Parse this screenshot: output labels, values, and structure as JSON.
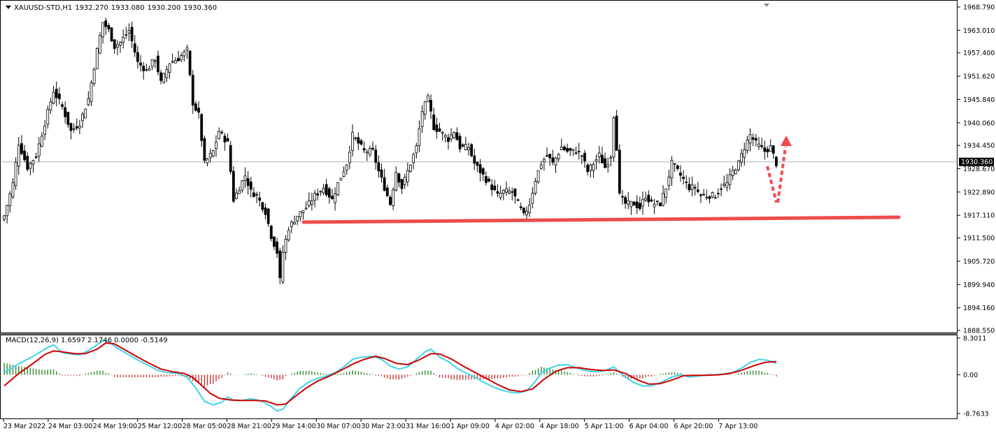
{
  "header": {
    "symbol": "XAUUSD-STD,H1",
    "open": "1932.270",
    "high": "1933.080",
    "low": "1930.200",
    "close": "1930.360"
  },
  "macd_header": {
    "label": "MACD(12,26,9)",
    "v1": "1.6597",
    "v2": "2.1746",
    "v3": "0.0000",
    "v4": "-0.5149"
  },
  "colors": {
    "bull": "#000000",
    "bear": "#000000",
    "support_line": "#ef4c4c",
    "arrow": "#ef4c4c",
    "macd_line": "#3fd4e8",
    "signal_line": "#cc0000",
    "hist_pos": "#2e8b2e",
    "hist_neg": "#cc3333",
    "price_line": "#8aa0a8"
  },
  "chart_data": [
    {
      "type": "candlestick",
      "title": "XAUUSD-STD,H1",
      "ylim": [
        1888.55,
        1968.79
      ],
      "y_ticks": [
        "1968.790",
        "1963.010",
        "1957.400",
        "1951.620",
        "1945.840",
        "1940.060",
        "1934.450",
        "1928.670",
        "1922.890",
        "1917.110",
        "1911.500",
        "1905.720",
        "1899.940",
        "1894.160",
        "1888.550"
      ],
      "x_ticks": [
        "23 Mar 2022",
        "24 Mar 03:00",
        "24 Mar 19:00",
        "25 Mar 12:00",
        "28 Mar 05:00",
        "28 Mar 21:00",
        "29 Mar 14:00",
        "30 Mar 07:00",
        "30 Mar 23:00",
        "31 Mar 16:00",
        "1 Apr 09:00",
        "4 Apr 02:00",
        "4 Apr 18:00",
        "5 Apr 11:00",
        "6 Apr 04:00",
        "6 Apr 20:00",
        "7 Apr 13:00"
      ],
      "current_price": "1930.360",
      "anchors": [
        [
          0,
          1917
        ],
        [
          3,
          1925
        ],
        [
          5,
          1935
        ],
        [
          8,
          1929
        ],
        [
          11,
          1932
        ],
        [
          14,
          1940
        ],
        [
          17,
          1948
        ],
        [
          20,
          1944
        ],
        [
          23,
          1938
        ],
        [
          26,
          1940
        ],
        [
          29,
          1946
        ],
        [
          32,
          1958
        ],
        [
          34,
          1965
        ],
        [
          36,
          1963
        ],
        [
          38,
          1959
        ],
        [
          40,
          1960
        ],
        [
          43,
          1963
        ],
        [
          46,
          1955
        ],
        [
          49,
          1953
        ],
        [
          52,
          1956
        ],
        [
          54,
          1950
        ],
        [
          57,
          1955
        ],
        [
          60,
          1956
        ],
        [
          63,
          1958
        ],
        [
          65,
          1945
        ],
        [
          67,
          1942
        ],
        [
          69,
          1930
        ],
        [
          72,
          1933
        ],
        [
          74,
          1938
        ],
        [
          77,
          1935
        ],
        [
          79,
          1921
        ],
        [
          81,
          1924
        ],
        [
          83,
          1927
        ],
        [
          85,
          1923
        ],
        [
          87,
          1922
        ],
        [
          90,
          1918
        ],
        [
          92,
          1912
        ],
        [
          94,
          1908
        ],
        [
          95,
          1901
        ],
        [
          96,
          1908
        ],
        [
          98,
          1914
        ],
        [
          101,
          1917
        ],
        [
          104,
          1919
        ],
        [
          107,
          1922
        ],
        [
          110,
          1924
        ],
        [
          113,
          1921
        ],
        [
          115,
          1925
        ],
        [
          118,
          1930
        ],
        [
          120,
          1937
        ],
        [
          122,
          1935
        ],
        [
          124,
          1933
        ],
        [
          127,
          1933
        ],
        [
          129,
          1928
        ],
        [
          131,
          1924
        ],
        [
          133,
          1920
        ],
        [
          135,
          1928
        ],
        [
          137,
          1924
        ],
        [
          139,
          1928
        ],
        [
          142,
          1934
        ],
        [
          144,
          1943
        ],
        [
          146,
          1946
        ],
        [
          148,
          1939
        ],
        [
          150,
          1938
        ],
        [
          153,
          1936
        ],
        [
          155,
          1938
        ],
        [
          157,
          1934
        ],
        [
          160,
          1934
        ],
        [
          162,
          1930
        ],
        [
          164,
          1928
        ],
        [
          167,
          1925
        ],
        [
          170,
          1922
        ],
        [
          172,
          1923
        ],
        [
          175,
          1923
        ],
        [
          177,
          1920
        ],
        [
          179,
          1917
        ],
        [
          181,
          1920
        ],
        [
          183,
          1926
        ],
        [
          185,
          1930
        ],
        [
          187,
          1932
        ],
        [
          189,
          1930
        ],
        [
          192,
          1934
        ],
        [
          194,
          1933
        ],
        [
          197,
          1933
        ],
        [
          199,
          1932
        ],
        [
          201,
          1928
        ],
        [
          203,
          1930
        ],
        [
          205,
          1932
        ],
        [
          207,
          1929
        ],
        [
          209,
          1932
        ],
        [
          210,
          1942
        ],
        [
          211,
          1934
        ],
        [
          212,
          1922
        ],
        [
          214,
          1920
        ],
        [
          217,
          1920
        ],
        [
          219,
          1919
        ],
        [
          221,
          1922
        ],
        [
          223,
          1920
        ],
        [
          226,
          1920
        ],
        [
          228,
          1924
        ],
        [
          230,
          1930
        ],
        [
          232,
          1928
        ],
        [
          234,
          1926
        ],
        [
          236,
          1924
        ],
        [
          238,
          1924
        ],
        [
          240,
          1922
        ],
        [
          243,
          1922
        ],
        [
          245,
          1922
        ],
        [
          247,
          1924
        ],
        [
          249,
          1925
        ],
        [
          251,
          1928
        ],
        [
          253,
          1930
        ],
        [
          255,
          1934
        ],
        [
          257,
          1937
        ],
        [
          259,
          1935
        ],
        [
          262,
          1933
        ],
        [
          264,
          1934
        ],
        [
          266,
          1930
        ]
      ],
      "series_name": "XAUUSD-STD,H1"
    },
    {
      "type": "macd",
      "title": "MACD(12,26,9)",
      "ylim": [
        -8.7633,
        8.3011
      ],
      "y_ticks": [
        "8.3011",
        "0.00",
        "-8.7633"
      ],
      "macd_anchors": [
        [
          0,
          0.5
        ],
        [
          5,
          2.5
        ],
        [
          10,
          4.2
        ],
        [
          14,
          5.8
        ],
        [
          17,
          6.8
        ],
        [
          20,
          5.0
        ],
        [
          23,
          4.7
        ],
        [
          26,
          4.5
        ],
        [
          29,
          5.5
        ],
        [
          32,
          6.8
        ],
        [
          34,
          7.8
        ],
        [
          36,
          7.5
        ],
        [
          39,
          6.0
        ],
        [
          43,
          4.5
        ],
        [
          47,
          3.0
        ],
        [
          50,
          2.0
        ],
        [
          53,
          1.0
        ],
        [
          56,
          0.5
        ],
        [
          60,
          0.3
        ],
        [
          63,
          -0.5
        ],
        [
          66,
          -3.0
        ],
        [
          69,
          -6.0
        ],
        [
          72,
          -6.8
        ],
        [
          75,
          -6.2
        ],
        [
          77,
          -5.0
        ],
        [
          79,
          -5.8
        ],
        [
          82,
          -5.8
        ],
        [
          85,
          -5.4
        ],
        [
          88,
          -5.8
        ],
        [
          90,
          -6.4
        ],
        [
          92,
          -7.2
        ],
        [
          94,
          -8.2
        ],
        [
          96,
          -7.8
        ],
        [
          99,
          -5.2
        ],
        [
          102,
          -3.0
        ],
        [
          105,
          -1.6
        ],
        [
          108,
          -0.8
        ],
        [
          111,
          -0.3
        ],
        [
          114,
          0.5
        ],
        [
          117,
          1.8
        ],
        [
          120,
          3.5
        ],
        [
          123,
          4.0
        ],
        [
          127,
          4.2
        ],
        [
          130,
          3.5
        ],
        [
          133,
          2.0
        ],
        [
          136,
          1.3
        ],
        [
          139,
          1.8
        ],
        [
          142,
          3.5
        ],
        [
          145,
          5.2
        ],
        [
          147,
          5.8
        ],
        [
          150,
          4.0
        ],
        [
          153,
          3.0
        ],
        [
          156,
          1.5
        ],
        [
          159,
          0.4
        ],
        [
          162,
          -0.5
        ],
        [
          165,
          -1.6
        ],
        [
          168,
          -2.6
        ],
        [
          171,
          -3.4
        ],
        [
          174,
          -3.9
        ],
        [
          177,
          -4.1
        ],
        [
          180,
          -3.6
        ],
        [
          183,
          -1.5
        ],
        [
          185,
          0.5
        ],
        [
          188,
          1.5
        ],
        [
          191,
          2.2
        ],
        [
          194,
          2.3
        ],
        [
          197,
          1.6
        ],
        [
          200,
          1.0
        ],
        [
          203,
          0.7
        ],
        [
          206,
          0.8
        ],
        [
          208,
          1.2
        ],
        [
          210,
          1.8
        ],
        [
          212,
          0.6
        ],
        [
          214,
          -0.5
        ],
        [
          217,
          -1.8
        ],
        [
          220,
          -2.5
        ],
        [
          223,
          -2.5
        ],
        [
          227,
          -1.5
        ],
        [
          230,
          -0.5
        ],
        [
          233,
          0.0
        ],
        [
          236,
          -0.5
        ],
        [
          239,
          -0.3
        ],
        [
          242,
          0.0
        ],
        [
          245,
          0.0
        ],
        [
          248,
          0.2
        ],
        [
          251,
          0.5
        ],
        [
          254,
          1.5
        ],
        [
          257,
          2.8
        ],
        [
          260,
          3.5
        ],
        [
          263,
          3.3
        ],
        [
          266,
          2.6
        ]
      ],
      "signal_anchors": [
        [
          0,
          -2.5
        ],
        [
          5,
          0.3
        ],
        [
          10,
          2.6
        ],
        [
          14,
          4.6
        ],
        [
          17,
          5.4
        ],
        [
          20,
          5.2
        ],
        [
          24,
          4.8
        ],
        [
          28,
          4.8
        ],
        [
          32,
          5.8
        ],
        [
          35,
          7.2
        ],
        [
          38,
          7.0
        ],
        [
          42,
          5.5
        ],
        [
          46,
          4.0
        ],
        [
          50,
          2.6
        ],
        [
          54,
          1.3
        ],
        [
          58,
          0.7
        ],
        [
          62,
          0.3
        ],
        [
          65,
          -0.6
        ],
        [
          68,
          -2.4
        ],
        [
          71,
          -4.2
        ],
        [
          74,
          -5.3
        ],
        [
          78,
          -5.7
        ],
        [
          82,
          -5.8
        ],
        [
          86,
          -5.8
        ],
        [
          90,
          -5.9
        ],
        [
          94,
          -6.8
        ],
        [
          97,
          -6.6
        ],
        [
          100,
          -5.0
        ],
        [
          104,
          -3.0
        ],
        [
          108,
          -1.4
        ],
        [
          112,
          -0.3
        ],
        [
          116,
          1.0
        ],
        [
          120,
          2.4
        ],
        [
          124,
          3.5
        ],
        [
          128,
          4.2
        ],
        [
          131,
          3.7
        ],
        [
          135,
          2.6
        ],
        [
          139,
          2.3
        ],
        [
          143,
          3.4
        ],
        [
          147,
          4.8
        ],
        [
          150,
          4.7
        ],
        [
          154,
          3.6
        ],
        [
          158,
          2.0
        ],
        [
          162,
          0.6
        ],
        [
          166,
          -0.8
        ],
        [
          170,
          -2.2
        ],
        [
          174,
          -3.4
        ],
        [
          178,
          -3.8
        ],
        [
          182,
          -3.2
        ],
        [
          186,
          -1.0
        ],
        [
          190,
          0.8
        ],
        [
          194,
          1.6
        ],
        [
          198,
          1.6
        ],
        [
          202,
          1.2
        ],
        [
          206,
          1.0
        ],
        [
          210,
          1.1
        ],
        [
          214,
          0.3
        ],
        [
          218,
          -1.1
        ],
        [
          222,
          -2.1
        ],
        [
          226,
          -2.0
        ],
        [
          230,
          -1.2
        ],
        [
          234,
          -0.2
        ],
        [
          238,
          -0.1
        ],
        [
          242,
          -0.1
        ],
        [
          246,
          0.0
        ],
        [
          250,
          0.3
        ],
        [
          254,
          1.0
        ],
        [
          258,
          2.0
        ],
        [
          262,
          2.8
        ],
        [
          266,
          3.0
        ]
      ],
      "series": [
        {
          "name": "MACD(12,26,9)"
        }
      ]
    }
  ]
}
